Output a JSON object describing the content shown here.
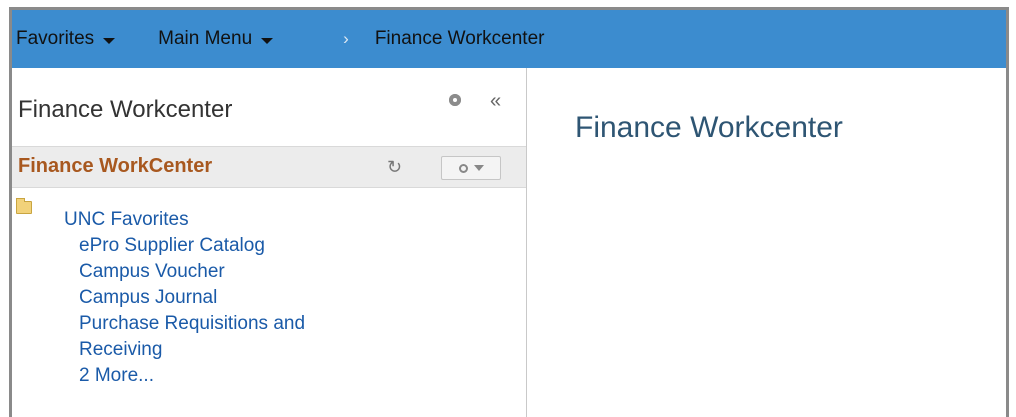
{
  "nav": {
    "favorites": "Favorites",
    "main_menu": "Main Menu",
    "separator": "›",
    "breadcrumb": "Finance Workcenter"
  },
  "left_panel": {
    "title": "Finance Workcenter",
    "collapse_glyph": "«",
    "section_title": "Finance WorkCenter",
    "refresh_glyph": "↻",
    "folder": {
      "label": "UNC Favorites",
      "items": [
        "ePro Supplier Catalog",
        "Campus Voucher",
        "Campus Journal",
        "Purchase Requisitions and",
        "Receiving",
        "2 More..."
      ]
    }
  },
  "main": {
    "title": "Finance Workcenter"
  },
  "colors": {
    "topbar": "#3c8ccf",
    "link": "#1a5aa8",
    "section_title": "#a8581f",
    "page_title": "#2e5573"
  }
}
